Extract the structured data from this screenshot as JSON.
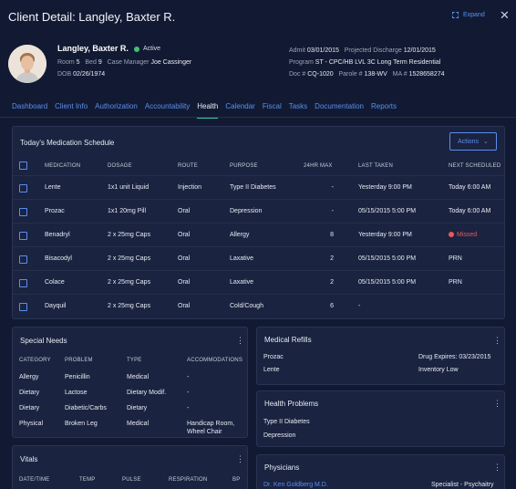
{
  "window": {
    "title": "Client Detail: Langley, Baxter R.",
    "expand_label": "Expand",
    "close_glyph": "✕"
  },
  "client": {
    "name": "Langley, Baxter R.",
    "status": "Active",
    "room_label": "Room",
    "room": "5",
    "bed_label": "Bed",
    "bed": "9",
    "case_manager_label": "Case Manager",
    "case_manager": "Joe Cassinger",
    "dob_label": "DOB",
    "dob": "02/26/1974",
    "admit_label": "Admit",
    "admit": "03/01/2015",
    "discharge_label": "Projected Discharge",
    "discharge": "12/01/2015",
    "program_label": "Program",
    "program": "ST - CPC/HB LVL 3C Long Term Residential",
    "doc_label": "Doc #",
    "doc": "CQ-1020",
    "parole_label": "Parole #",
    "parole": "138-WV",
    "ma_label": "MA #",
    "ma": "1528658274"
  },
  "tabs": [
    "Dashboard",
    "Client Info",
    "Authorization",
    "Accountability",
    "Health",
    "Calendar",
    "Fiscal",
    "Tasks",
    "Documentation",
    "Reports"
  ],
  "active_tab": "Health",
  "medication": {
    "title": "Today's Medication Schedule",
    "actions_label": "Actions",
    "columns": [
      "MEDICATION",
      "DOSAGE",
      "ROUTE",
      "PURPOSE",
      "24HR MAX",
      "LAST TAKEN",
      "NEXT SCHEDULED"
    ],
    "rows": [
      [
        "Lente",
        "1x1 unit Liquid",
        "Injection",
        "Type II Diabetes",
        "-",
        "Yesterday 9:00 PM",
        "Today 6:00 AM"
      ],
      [
        "Prozac",
        "1x1 20mg Pill",
        "Oral",
        "Depression",
        "-",
        "05/15/2015 5:00 PM",
        "Today 6:00 AM"
      ],
      [
        "Benadryl",
        "2 x 25mg Caps",
        "Oral",
        "Allergy",
        "8",
        "Yesterday 9:00 PM",
        "Missed"
      ],
      [
        "Bisacodyl",
        "2 x 25mg Caps",
        "Oral",
        "Laxative",
        "2",
        "05/15/2015 5:00 PM",
        "PRN"
      ],
      [
        "Colace",
        "2 x 25mg Caps",
        "Oral",
        "Laxative",
        "2",
        "05/15/2015 5:00 PM",
        "PRN"
      ],
      [
        "Dayquil",
        "2 x 25mg Caps",
        "Oral",
        "Cold/Cough",
        "6",
        "-",
        ""
      ]
    ]
  },
  "special_needs": {
    "title": "Special Needs",
    "columns": [
      "CATEGORY",
      "PROBLEM",
      "TYPE",
      "ACCOMMODATIONS"
    ],
    "rows": [
      [
        "Allergy",
        "Penicillin",
        "Medical",
        "-"
      ],
      [
        "Dietary",
        "Lactose",
        "Dietary Modif.",
        "-"
      ],
      [
        "Dietary",
        "Diabetic/Carbs",
        "Dietary",
        "-"
      ],
      [
        "Physical",
        "Broken Leg",
        "Medical",
        "Handicap Room,",
        "Wheel Chair"
      ]
    ]
  },
  "medical_refills": {
    "title": "Medical Refills",
    "rows": [
      [
        "Prozac",
        "Drug Expires: 03/23/2015"
      ],
      [
        "Lente",
        "Inventory Low"
      ]
    ]
  },
  "health_problems": {
    "title": "Health Problems",
    "items": [
      "Type II Diabetes",
      "Depression"
    ]
  },
  "vitals": {
    "title": "Vitals",
    "columns": [
      "DATE/TIME",
      "TEMP",
      "PULSE",
      "RESPIRATION",
      "BP"
    ]
  },
  "physicians": {
    "title": "Physicians",
    "rows": [
      [
        "Dr. Ken Goldberg M.D.",
        "Specialist - Psychaitry"
      ]
    ]
  },
  "colors": {
    "background": "#121a33",
    "panel": "#1a2340",
    "accent": "#5a8ff0",
    "active_tab_underline": "#3ec4b0",
    "missed": "#e85a5a",
    "status_active": "#3ec46d"
  }
}
